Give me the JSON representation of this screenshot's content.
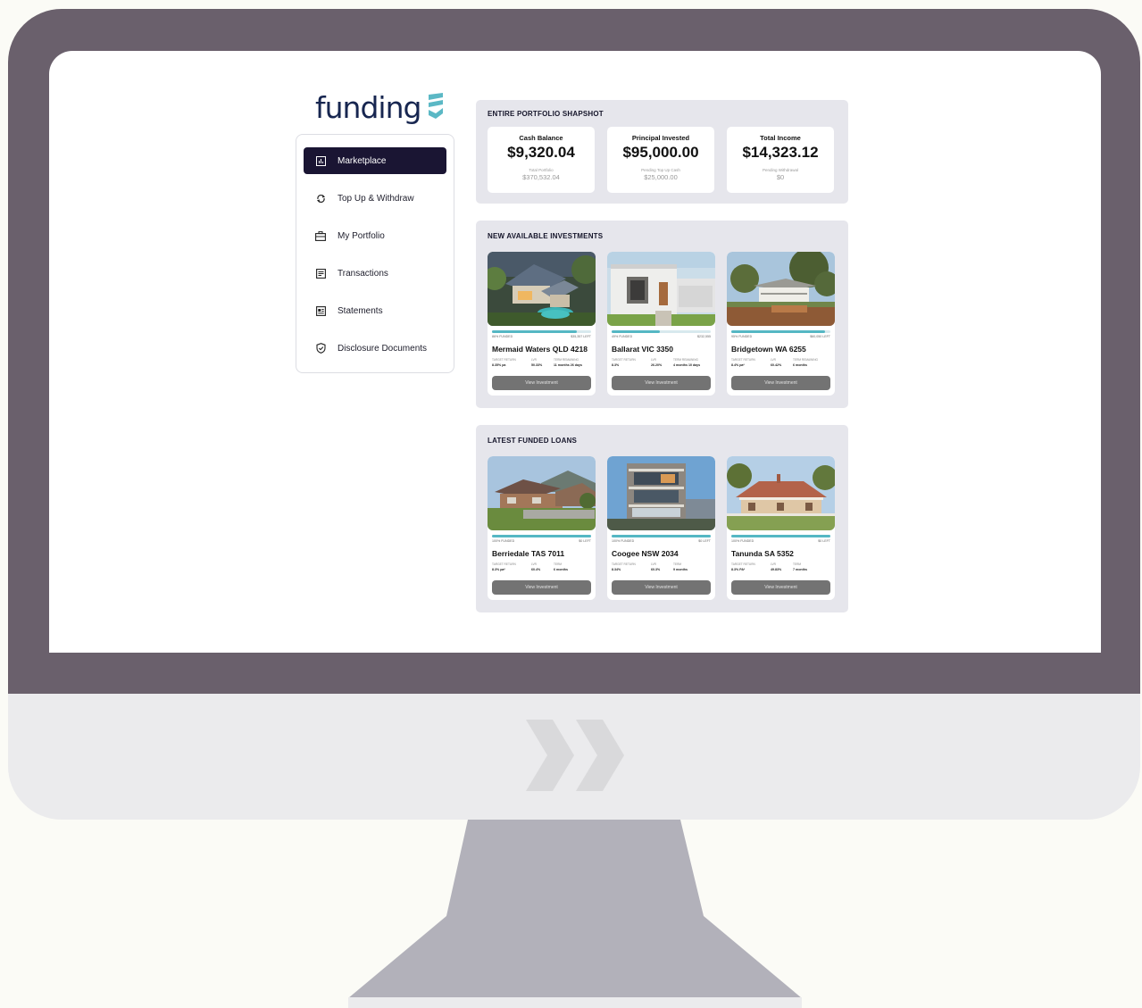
{
  "logo": {
    "text": "funding"
  },
  "nav": [
    {
      "label": "Marketplace",
      "icon": "chart-icon",
      "active": true
    },
    {
      "label": "Top Up & Withdraw",
      "icon": "refresh-icon",
      "active": false
    },
    {
      "label": "My Portfolio",
      "icon": "briefcase-icon",
      "active": false
    },
    {
      "label": "Transactions",
      "icon": "document-icon",
      "active": false
    },
    {
      "label": "Statements",
      "icon": "statement-icon",
      "active": false
    },
    {
      "label": "Disclosure Documents",
      "icon": "shield-check-icon",
      "active": false
    }
  ],
  "snapshot": {
    "title": "ENTIRE PORTFOLIO SHAPSHOT",
    "stats": [
      {
        "label": "Cash Balance",
        "value": "$9,320.04",
        "sub_label": "Total Portfolio",
        "sub_value": "$370,532.04"
      },
      {
        "label": "Principal Invested",
        "value": "$95,000.00",
        "sub_label": "Pending Top Up Cash",
        "sub_value": "$25,000.00"
      },
      {
        "label": "Total Income",
        "value": "$14,323.12",
        "sub_label": "Pending Withdrawal",
        "sub_value": "$0"
      }
    ]
  },
  "new_investments": {
    "title": "NEW AVAILABLE INVESTMENTS",
    "cards": [
      {
        "funded": "86% FUNDED",
        "left": "$35,357 LEFT",
        "funded_fraction": 0.86,
        "title": "Mermaid Waters QLD 4218",
        "k1": "TARGET RETURN",
        "k2": "LVR",
        "k3": "TERM REMAINING",
        "v1": "8.35% pa",
        "v2": "50.33%",
        "v3": "11 months 26 days",
        "button": "View Investment"
      },
      {
        "funded": "49% FUNDED",
        "left": "$232,555",
        "funded_fraction": 0.49,
        "title": "Ballarat VIC 3350",
        "k1": "TARGET RETURN",
        "k2": "LVR",
        "k3": "TERM REMAINING",
        "v1": "8.3%",
        "v2": "26.20%",
        "v3": "4 months 10 days",
        "button": "View Investment"
      },
      {
        "funded": "95% FUNDED",
        "left": "$60,050 LEFT",
        "funded_fraction": 0.95,
        "title": "Bridgetown WA 6255",
        "k1": "TARGET RETURN",
        "k2": "LVR",
        "k3": "TERM REMAINING",
        "v1": "8.4% pa*",
        "v2": "60.42%",
        "v3": "6 months",
        "button": "View Investment"
      }
    ]
  },
  "funded_loans": {
    "title": "LATEST FUNDED LOANS",
    "cards": [
      {
        "funded": "100% FUNDED",
        "left": "$0 LEFT",
        "funded_fraction": 1.0,
        "title": "Berriedale TAS 7011",
        "k1": "TARGET RETURN",
        "k2": "LVR",
        "k3": "TERM",
        "v1": "8.3% pa*",
        "v2": "60.4%",
        "v3": "6 months",
        "button": "View Investment"
      },
      {
        "funded": "100% FUNDED",
        "left": "$0 LEFT",
        "funded_fraction": 1.0,
        "title": "Coogee NSW 2034",
        "k1": "TARGET RETURN",
        "k2": "LVR",
        "k3": "TERM",
        "v1": "8.34%",
        "v2": "60.3%",
        "v3": "9 months",
        "button": "View Investment"
      },
      {
        "funded": "100% FUNDED",
        "left": "$0 LEFT",
        "funded_fraction": 1.0,
        "title": "Tanunda SA 5352",
        "k1": "TARGET RETURN",
        "k2": "LVR",
        "k3": "TERM",
        "v1": "8.3% PA*",
        "v2": "49.83%",
        "v3": "7 months",
        "button": "View Investment"
      }
    ]
  },
  "colors": {
    "bezel": "#6a606c",
    "chin": "#ebebed",
    "stand": "#b2b1ba",
    "brand_navy": "#172650",
    "brand_teal": "#5bb8c5",
    "active_nav": "#1a1533"
  }
}
